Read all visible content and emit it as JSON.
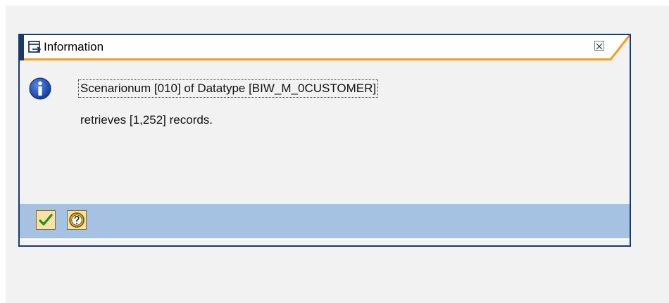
{
  "dialog": {
    "title": "Information",
    "icons": {
      "title_icon": "window-arrow-icon",
      "close": "close-icon",
      "info": "info-icon",
      "ok": "checkmark-icon",
      "help": "help-icon"
    },
    "message": {
      "line1": "Scenarionum [010] of Datatype [BIW_M_0CUSTOMER]",
      "line2": "retrieves [1,252] records."
    }
  },
  "colors": {
    "title_accent": "#f0a01e",
    "frame_border": "#1a3a6b",
    "footer_bg": "#a6c2e3",
    "button_bg": "#f4e2a8",
    "info_blue": "#1f4fbf",
    "ok_green": "#2e8b16"
  }
}
